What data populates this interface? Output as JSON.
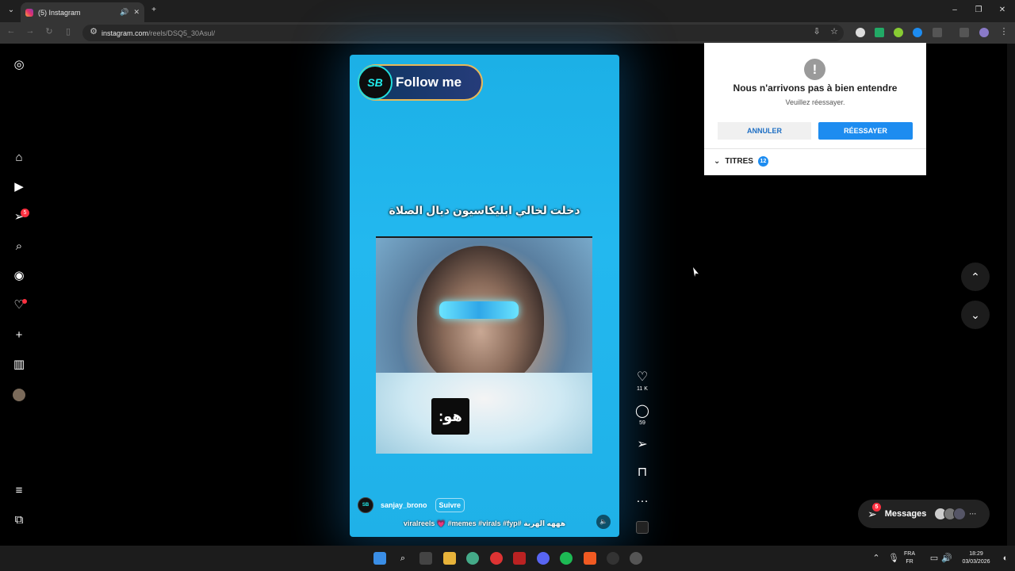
{
  "browser": {
    "tab_title": "(5) Instagram",
    "url_domain": "instagram.com",
    "url_path": "/reels/DSQ5_30Asul/"
  },
  "sidebar": {
    "notifications_badge": "5"
  },
  "reel": {
    "follow_logo": "SB",
    "follow_text": "Follow me",
    "caption_arabic": "دخلت لخالي ابليكاسيون ديال الصلاة",
    "subtitle": "هو:",
    "username": "sanjay_brono",
    "follow_button": "Suivre",
    "hashtags": "viralreels 💗 #memes #virals #fyp# هههه الهربة",
    "avatar_label": "SB"
  },
  "actions": {
    "likes": "11 K",
    "comments": "59"
  },
  "popup": {
    "title": "Nous n'arrivons pas à bien entendre",
    "subtitle": "Veuillez réessayer.",
    "cancel_label": "ANNULER",
    "retry_label": "RÉESSAYER",
    "titles_label": "TITRES",
    "titles_count": "12"
  },
  "messages": {
    "label": "Messages",
    "badge": "5"
  },
  "taskbar": {
    "lang_top": "FRA",
    "lang_bottom": "FR",
    "time": "18:29",
    "date": "03/03/2026"
  },
  "colors": {
    "reel_bg": "#1cb0e6",
    "accent_blue": "#1d8cf0",
    "badge_red": "#ff3040"
  }
}
